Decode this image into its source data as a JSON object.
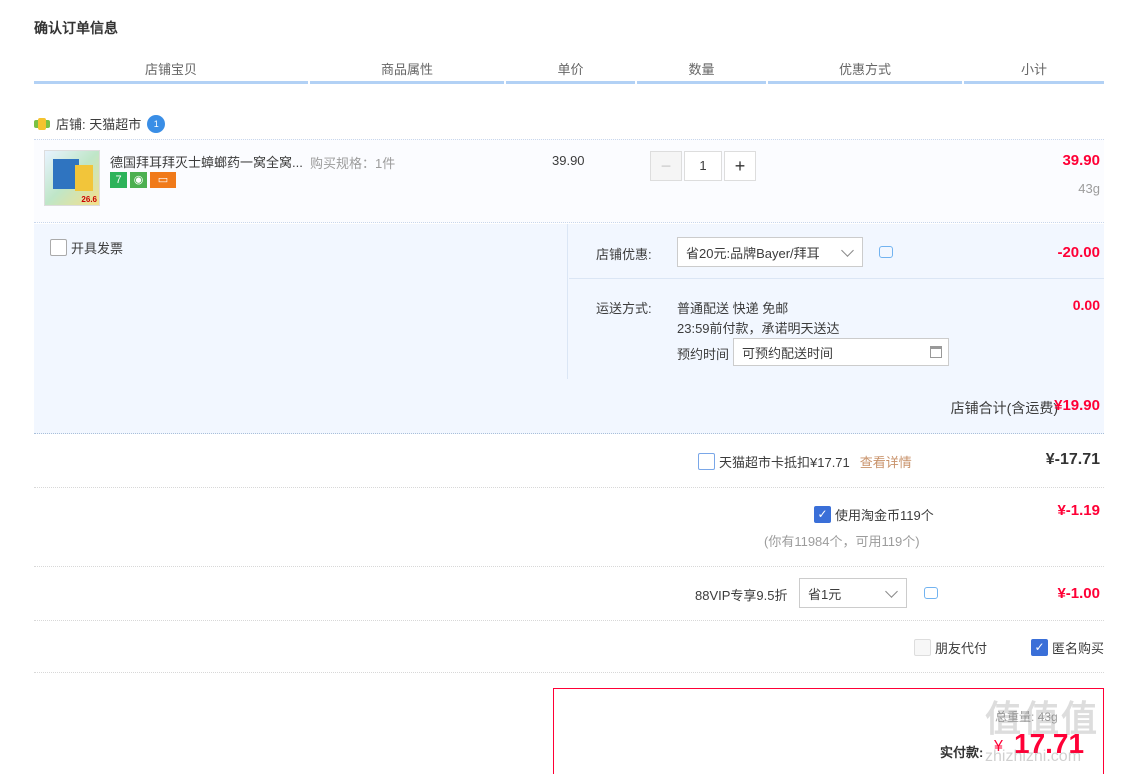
{
  "page_title": "确认订单信息",
  "headers": [
    "店铺宝贝",
    "商品属性",
    "单价",
    "数量",
    "优惠方式",
    "小计"
  ],
  "shop": {
    "label": "店铺: 天猫超市",
    "badge": "1"
  },
  "item": {
    "name": "德国拜耳拜灭士蟑螂药一窝全窝...",
    "spec": "购买规格：1件",
    "price": "39.90",
    "quantity": "1",
    "minus": "−",
    "plus": "+",
    "subtotal": "39.90",
    "weight": "43g",
    "thumb_text": "26.6",
    "tags": [
      {
        "text": "7",
        "color": "#2db35a"
      },
      {
        "text": "◉",
        "color": "#4cb050"
      },
      {
        "text": "▭",
        "color": "#f07a1a"
      }
    ]
  },
  "invoice": {
    "label": "开具发票"
  },
  "shop_discount": {
    "label": "店铺优惠:",
    "value": "省20元:品牌Bayer/拜耳",
    "amount": "-20.00"
  },
  "shipping": {
    "label": "运送方式:",
    "method": "普通配送 快递 免邮",
    "note": "23:59前付款，承诺明天送达",
    "schedule_label": "预约时间",
    "schedule_placeholder": "可预约配送时间",
    "amount": "0.00"
  },
  "shop_total": {
    "label": "店铺合计(含运费)",
    "amount": "¥19.90"
  },
  "tmall_card": {
    "label": "天猫超市卡抵扣¥17.71",
    "link": "查看详情",
    "amount": "¥-17.71"
  },
  "coins": {
    "label": "使用淘金币119个",
    "note": "(你有11984个，可用119个)",
    "amount": "¥-1.19"
  },
  "vip": {
    "label": "88VIP专享9.5折",
    "value": "省1元",
    "amount": "¥-1.00"
  },
  "friend_pay": {
    "label": "朋友代付"
  },
  "anonymous": {
    "label": "匿名购买"
  },
  "pay": {
    "weight_label": "总重量: 43g",
    "label": "实付款:",
    "currency": "¥",
    "amount": "17.71"
  },
  "watermark": {
    "line1": "值值值",
    "line2": "zhizhizhi.com"
  },
  "colors": {
    "accent_red": "#ff0036",
    "header_line": "#b2d1f5",
    "panel_bg": "#f2f7ff",
    "checkbox_blue": "#3a6fd8"
  }
}
